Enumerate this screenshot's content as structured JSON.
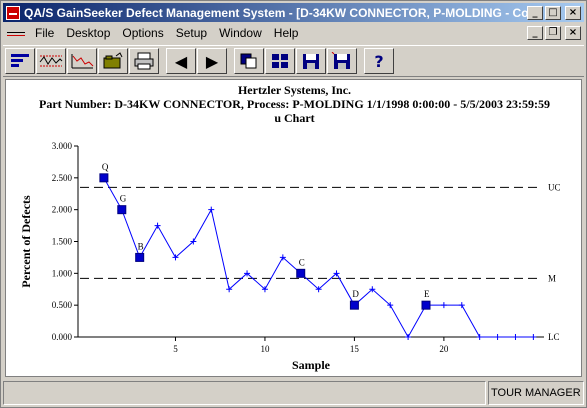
{
  "window": {
    "title": "QA/S GainSeeker Defect Management System - [D-34KW CONNECTOR, P-MOLDING - Con..."
  },
  "menu": [
    "File",
    "Desktop",
    "Options",
    "Setup",
    "Window",
    "Help"
  ],
  "toolbar": {
    "tools": [
      "histogram-tool",
      "trend-chart-tool",
      "control-chart-tool",
      "open-folder-tool",
      "print-tool",
      "previous-tool",
      "next-tool",
      "copy-tool",
      "grid-tool",
      "save-tool",
      "save-as-tool",
      "help-tool"
    ],
    "prev_glyph": "◀",
    "next_glyph": "▶",
    "help_glyph": "?"
  },
  "header": {
    "company": "Hertzler Systems, Inc.",
    "info": "Part Number: D-34KW CONNECTOR, Process: P-MOLDING   1/1/1998 0:00:00 - 5/5/2003 23:59:59",
    "chart_name": "u Chart"
  },
  "status": {
    "user": "TOUR MANAGER"
  },
  "chart_data": {
    "type": "line",
    "title": "u Chart",
    "xlabel": "Sample",
    "ylabel": "Percent of Defects",
    "xlim": [
      0,
      25
    ],
    "ylim": [
      0,
      3
    ],
    "xticks": [
      5,
      10,
      15,
      20
    ],
    "yticks": [
      "0.000",
      "0.500",
      "1.000",
      "1.500",
      "2.000",
      "2.500",
      "3.000"
    ],
    "x": [
      1,
      2,
      3,
      4,
      5,
      6,
      7,
      8,
      9,
      10,
      11,
      12,
      13,
      14,
      15,
      16,
      17,
      18,
      19,
      20,
      21,
      22,
      23,
      24,
      25
    ],
    "values": [
      2.5,
      2.0,
      1.25,
      1.75,
      1.25,
      1.5,
      2.0,
      0.75,
      1.0,
      0.75,
      1.25,
      1.0,
      0.75,
      1.0,
      0.5,
      0.75,
      0.5,
      0.0,
      0.5,
      0.5,
      0.5,
      0.0,
      0.0,
      0.0,
      0.0
    ],
    "flagged": [
      {
        "x": 1,
        "label": "Q"
      },
      {
        "x": 2,
        "label": "G"
      },
      {
        "x": 3,
        "label": "B"
      },
      {
        "x": 12,
        "label": "C"
      },
      {
        "x": 15,
        "label": "D"
      },
      {
        "x": 19,
        "label": "E"
      }
    ],
    "control_limits": {
      "ucl": {
        "value": 2.35,
        "label": "UC"
      },
      "mean": {
        "value": 0.92,
        "label": "M"
      },
      "lcl": {
        "value": 0.0,
        "label": "LC"
      }
    },
    "grid": false,
    "colors": {
      "line": "#0000ff",
      "marker": "#0000cc",
      "limits": "#000000"
    }
  }
}
